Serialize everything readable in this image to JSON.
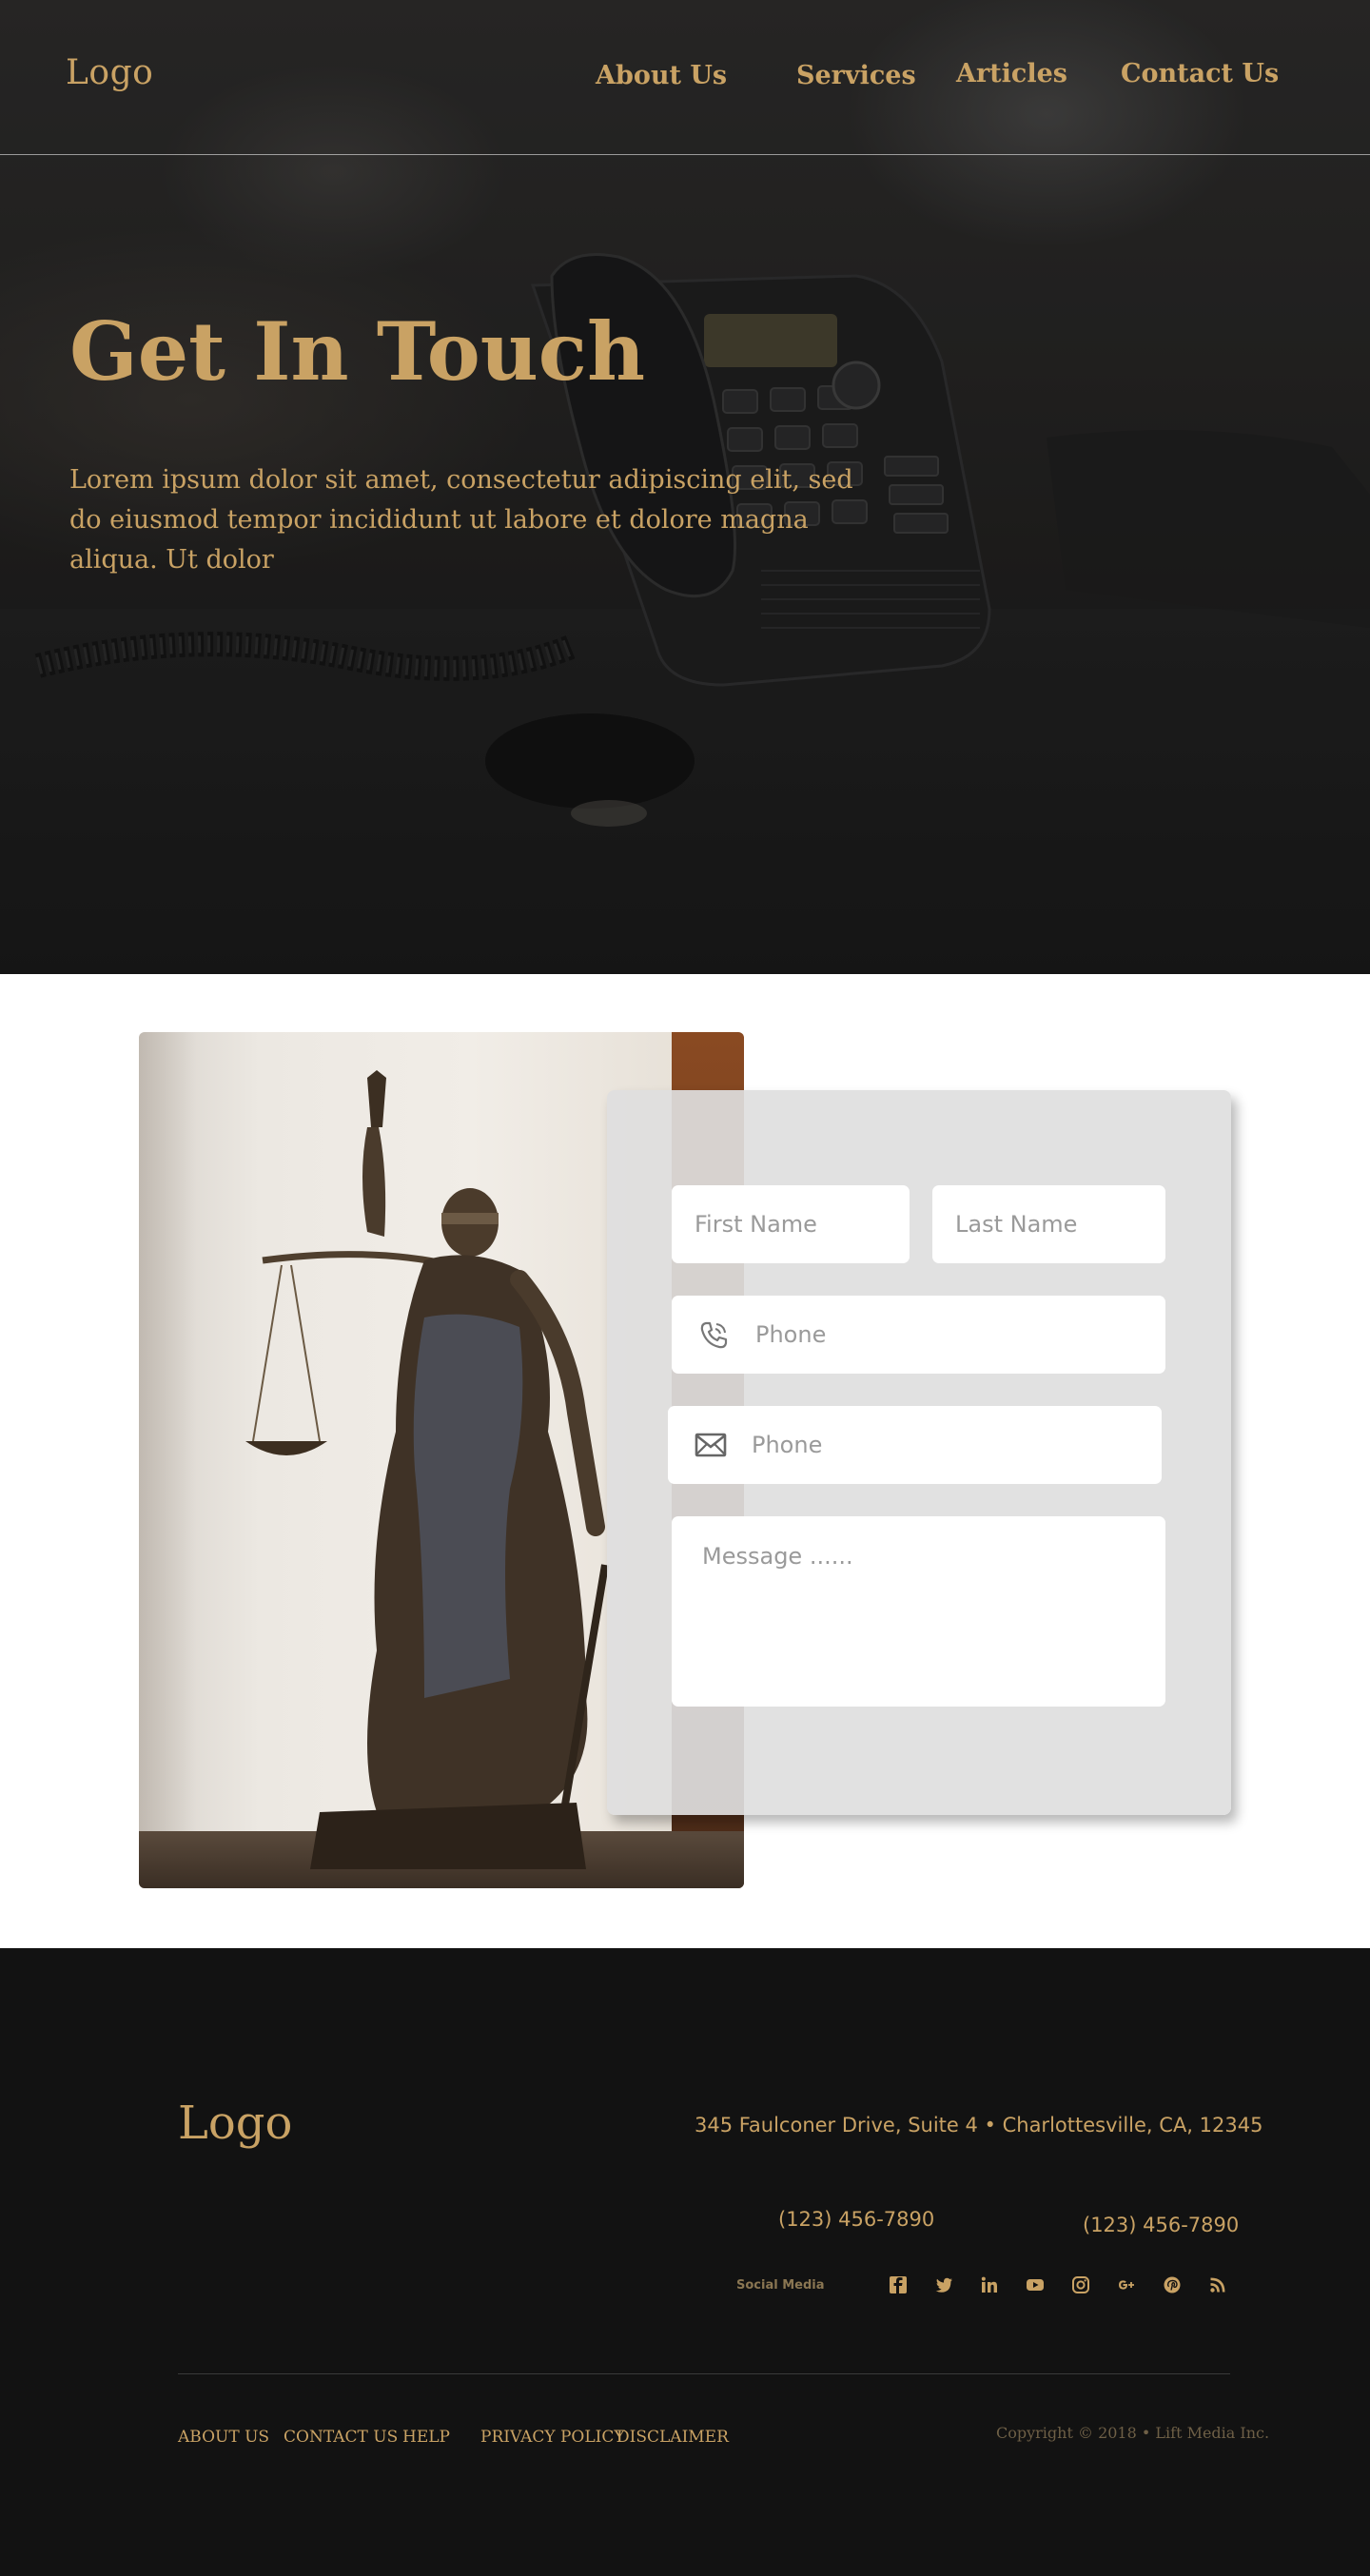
{
  "header": {
    "logo": "Logo",
    "nav": [
      "About Us",
      "Services",
      "Articles",
      "Contact Us"
    ]
  },
  "hero": {
    "title": "Get In Touch",
    "text": "Lorem ipsum dolor sit amet, consectetur adipiscing elit, sed do eiusmod  tempor incididunt ut labore et dolore magna aliqua. Ut dolor"
  },
  "form": {
    "first_name_placeholder": "First Name",
    "last_name_placeholder": "Last Name",
    "phone_placeholder": "Phone",
    "email_placeholder": "Phone",
    "message_placeholder": "Message ......",
    "phone_icon": "phone-icon",
    "email_icon": "envelope-icon"
  },
  "footer": {
    "logo": "Logo",
    "address": "345 Faulconer Drive, Suite 4 • Charlottesville, CA, 12345",
    "phone_1": "(123) 456-7890",
    "phone_2": "(123) 456-7890",
    "social_label": "Social Media",
    "social_icons": [
      "facebook-icon",
      "twitter-icon",
      "linkedin-icon",
      "youtube-icon",
      "instagram-icon",
      "google-plus-icon",
      "pinterest-icon",
      "rss-icon"
    ],
    "links": [
      "ABOUT US",
      "CONTACT US",
      "HELP",
      "PRIVACY POLICY",
      "DISCLAIMER"
    ],
    "copyright": "Copyright © 2018 • Lift Media Inc."
  },
  "colors": {
    "accent": "#c9a264",
    "footer_bg": "#121212",
    "form_card_bg": "#dedede"
  }
}
